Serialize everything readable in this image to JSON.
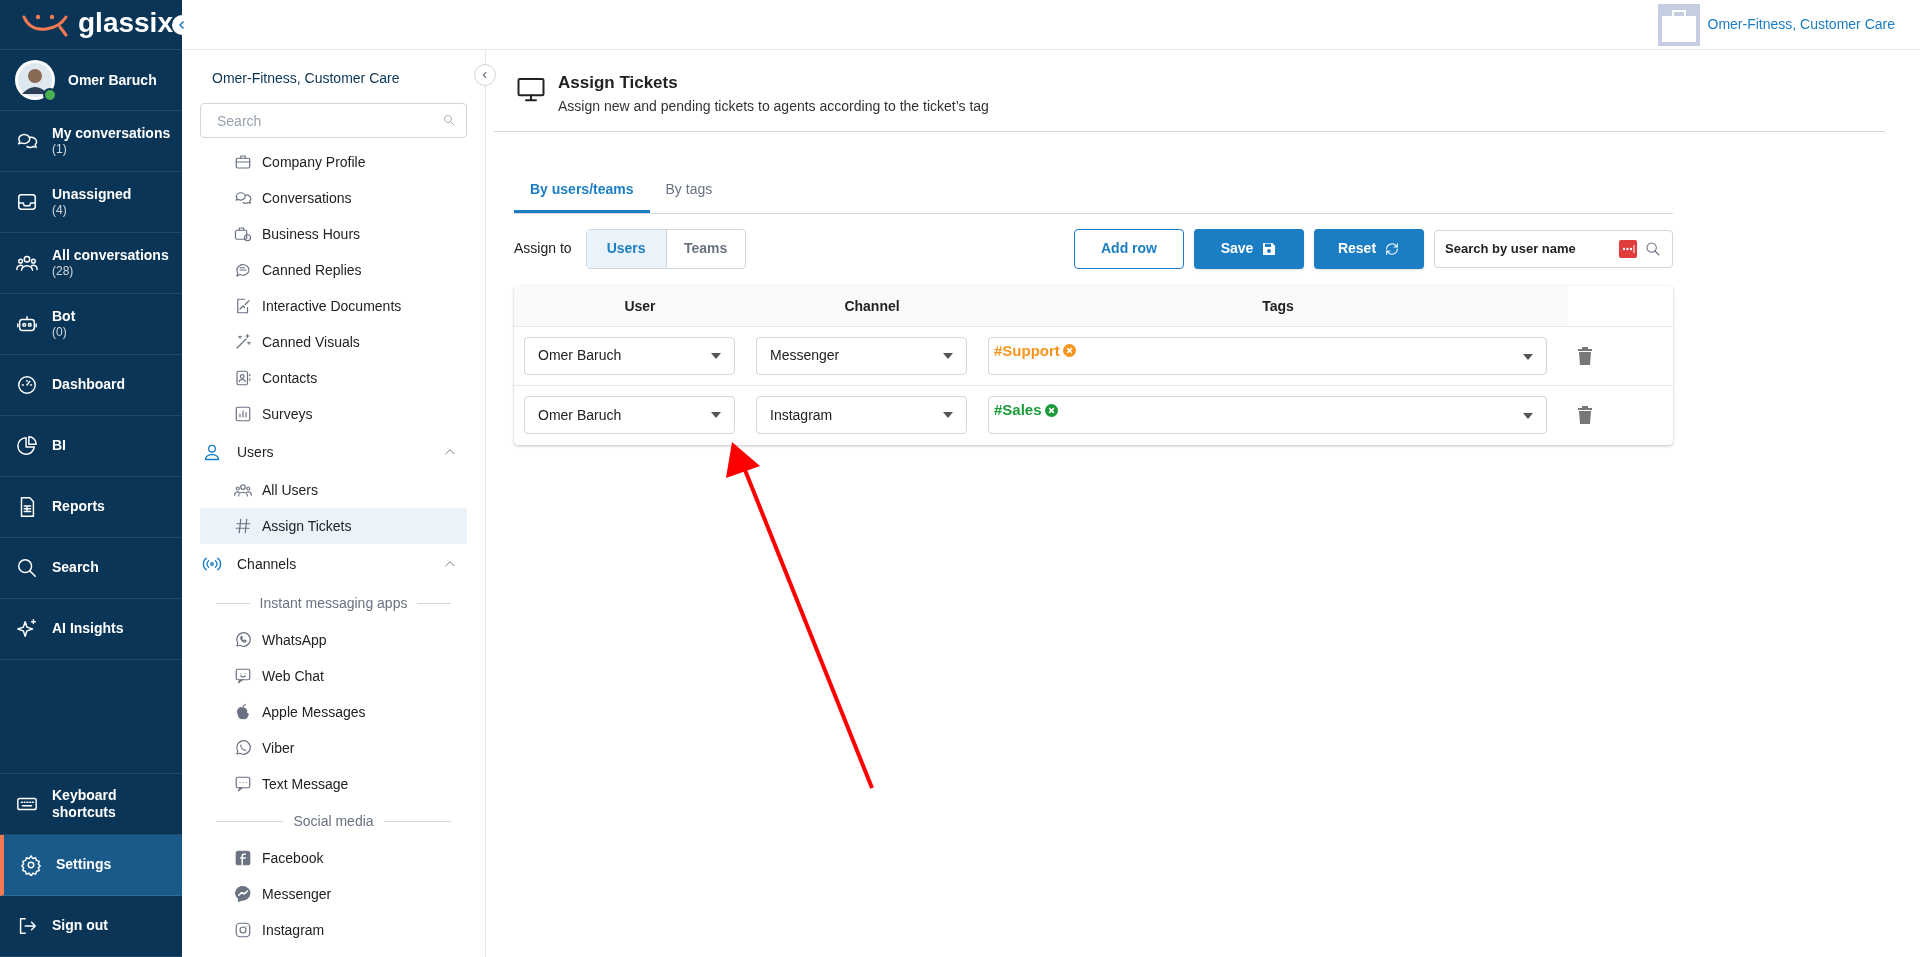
{
  "brand": {
    "logo_text": "glassix"
  },
  "top_bar": {
    "account": "Omer-Fitness, Customer Care"
  },
  "main_nav": {
    "user": {
      "name": "Omer Baruch",
      "online": true
    },
    "items": [
      {
        "label": "My conversations",
        "count": "(1)",
        "selected": false
      },
      {
        "label": "Unassigned",
        "count": "(4)",
        "selected": false
      },
      {
        "label": "All conversations",
        "count": "(28)",
        "selected": false
      },
      {
        "label": "Bot",
        "count": "(0)",
        "selected": false
      },
      {
        "label": "Dashboard",
        "selected": false
      },
      {
        "label": "BI",
        "selected": false
      },
      {
        "label": "Reports",
        "selected": false
      },
      {
        "label": "Search",
        "selected": false
      },
      {
        "label": "AI Insights",
        "selected": false
      }
    ],
    "bottom_items": [
      {
        "label": "Keyboard shortcuts",
        "selected": false
      },
      {
        "label": "Settings",
        "selected": true
      },
      {
        "label": "Sign out",
        "selected": false
      }
    ]
  },
  "settings_nav": {
    "account": "Omer-Fitness, Customer Care",
    "search": {
      "placeholder": "Search"
    },
    "items": [
      {
        "kind": "link",
        "label": "Company Profile",
        "selected": false
      },
      {
        "kind": "link",
        "label": "Conversations",
        "selected": false
      },
      {
        "kind": "link",
        "label": "Business Hours",
        "selected": false
      },
      {
        "kind": "link",
        "label": "Canned Replies",
        "selected": false
      },
      {
        "kind": "link",
        "label": "Interactive Documents",
        "selected": false
      },
      {
        "kind": "link",
        "label": "Canned Visuals",
        "selected": false
      },
      {
        "kind": "link",
        "label": "Contacts",
        "selected": false
      },
      {
        "kind": "link",
        "label": "Surveys",
        "selected": false
      },
      {
        "kind": "group",
        "label": "Users",
        "expanded": true
      },
      {
        "kind": "link",
        "label": "All Users",
        "selected": false
      },
      {
        "kind": "link",
        "label": "Assign Tickets",
        "selected": true
      },
      {
        "kind": "group",
        "label": "Channels",
        "expanded": true
      },
      {
        "kind": "heading",
        "label": "Instant messaging apps"
      },
      {
        "kind": "link",
        "label": "WhatsApp",
        "selected": false
      },
      {
        "kind": "link",
        "label": "Web Chat",
        "selected": false
      },
      {
        "kind": "link",
        "label": "Apple Messages",
        "selected": false
      },
      {
        "kind": "link",
        "label": "Viber",
        "selected": false
      },
      {
        "kind": "link",
        "label": "Text Message",
        "selected": false
      },
      {
        "kind": "heading",
        "label": "Social media"
      },
      {
        "kind": "link",
        "label": "Facebook",
        "selected": false
      },
      {
        "kind": "link",
        "label": "Messenger",
        "selected": false
      },
      {
        "kind": "link",
        "label": "Instagram",
        "selected": false
      }
    ]
  },
  "page": {
    "title": "Assign Tickets",
    "subtitle": "Assign new and pending tickets to agents according to the ticket’s tag",
    "tabs": [
      {
        "label": "By users/teams",
        "selected": true
      },
      {
        "label": "By tags",
        "selected": false
      }
    ],
    "assign_to": {
      "label": "Assign to",
      "options": [
        {
          "label": "Users",
          "selected": true
        },
        {
          "label": "Teams",
          "selected": false
        }
      ]
    },
    "buttons": [
      {
        "label": "Add row",
        "kind": "outline"
      },
      {
        "label": "Save",
        "kind": "save"
      },
      {
        "label": "Reset",
        "kind": "reset"
      }
    ],
    "search": {
      "placeholder": "Search by user name"
    },
    "table": {
      "columns": [
        "User",
        "Channel",
        "Tags"
      ],
      "rows": [
        {
          "user": "Omer Baruch",
          "channel": "Messenger",
          "tags": [
            {
              "label": "#Support",
              "color": "#f7941d"
            }
          ]
        },
        {
          "user": "Omer Baruch",
          "channel": "Instagram",
          "tags": [
            {
              "label": "#Sales",
              "color": "#1a9b3a"
            }
          ]
        }
      ]
    }
  }
}
